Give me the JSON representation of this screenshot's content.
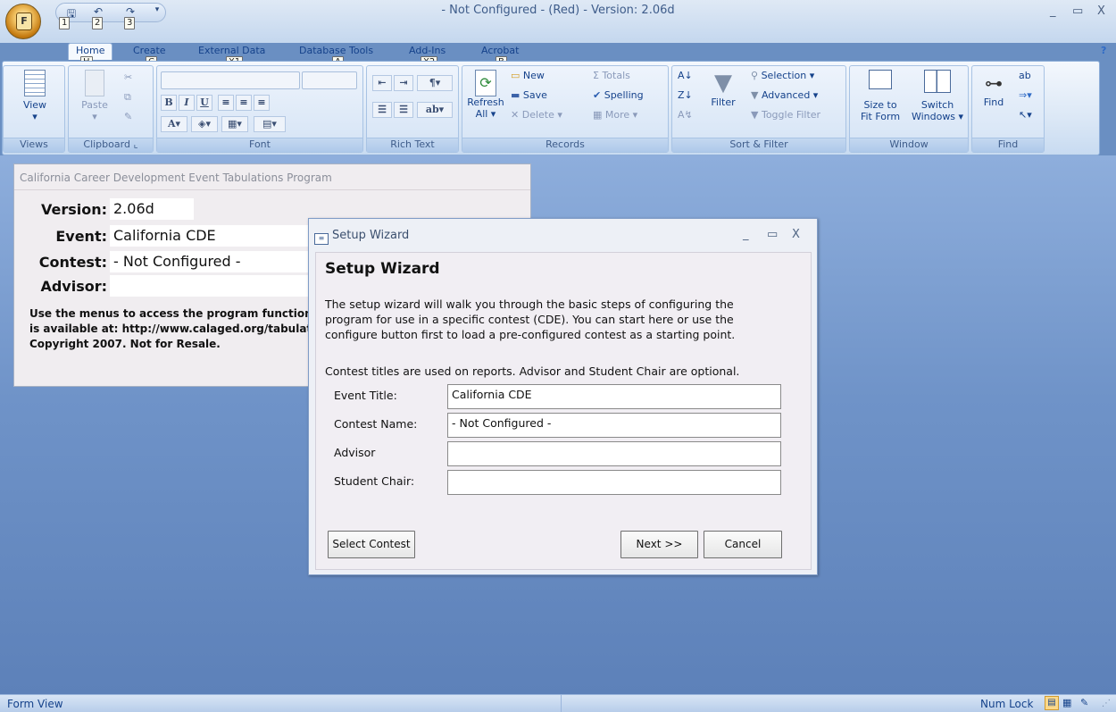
{
  "window": {
    "title": "- Not Configured - (Red) - Version: 2.06d",
    "minimize": "_",
    "restore": "▭",
    "close": "X",
    "help": "?"
  },
  "office_button": {
    "letter": "F"
  },
  "qat": {
    "keytips": [
      "1",
      "2",
      "3"
    ]
  },
  "tabs": [
    {
      "label": "Home",
      "keytip": "H"
    },
    {
      "label": "Create",
      "keytip": "C"
    },
    {
      "label": "External Data",
      "keytip": "X1"
    },
    {
      "label": "Database Tools",
      "keytip": "A"
    },
    {
      "label": "Add-Ins",
      "keytip": "X2"
    },
    {
      "label": "Acrobat",
      "keytip": "B"
    }
  ],
  "ribbon": {
    "groups": {
      "views": "Views",
      "clipboard": "Clipboard",
      "font": "Font",
      "rich_text": "Rich Text",
      "records": "Records",
      "sort_filter": "Sort & Filter",
      "window": "Window",
      "find": "Find"
    },
    "view": "View",
    "paste": "Paste",
    "refresh": "Refresh",
    "refresh_all": "All ▾",
    "new": "New",
    "save": "Save",
    "delete": "Delete ▾",
    "totals": "Totals",
    "spelling": "Spelling",
    "more": "More ▾",
    "filter": "Filter",
    "selection": "Selection ▾",
    "advanced": "Advanced ▾",
    "toggle_filter": "Toggle Filter",
    "size_to": "Size to",
    "fit_form": "Fit Form",
    "switch": "Switch",
    "windows": "Windows ▾",
    "find": "Find"
  },
  "main_form": {
    "title": "California Career Development Event Tabulations Program",
    "version_label": "Version:",
    "version_value": "2.06d",
    "event_label": "Event:",
    "event_value": "California CDE",
    "contest_label": "Contest:",
    "contest_value": "- Not Configured -",
    "advisor_label": "Advisor:",
    "advisor_value": "",
    "info_line1": "Use the menus to access the program functions",
    "info_line2": "is available at: http://www.calaged.org/tabulat",
    "info_line3": "Copyright 2007. Not for Resale."
  },
  "dialog": {
    "title": "Setup Wizard",
    "heading": "Setup Wizard",
    "para1_line1": "The setup wizard will walk you through the basic steps of configuring the",
    "para1_line2": "program for use in a specific contest (CDE).  You can start here or use the",
    "para1_line3": "configure button first to load a pre-configured contest as a starting point.",
    "para2": "Contest titles are used on reports.  Advisor and Student Chair are optional.",
    "fields": [
      {
        "label": "Event Title:",
        "value": "California CDE"
      },
      {
        "label": "Contest Name:",
        "value": "- Not Configured -"
      },
      {
        "label": "Advisor",
        "value": ""
      },
      {
        "label": "Student Chair:",
        "value": ""
      }
    ],
    "select_contest": "Select Contest",
    "next": "Next >>",
    "cancel": "Cancel"
  },
  "status_bar": {
    "left": "Form View",
    "num_lock": "Num Lock"
  }
}
